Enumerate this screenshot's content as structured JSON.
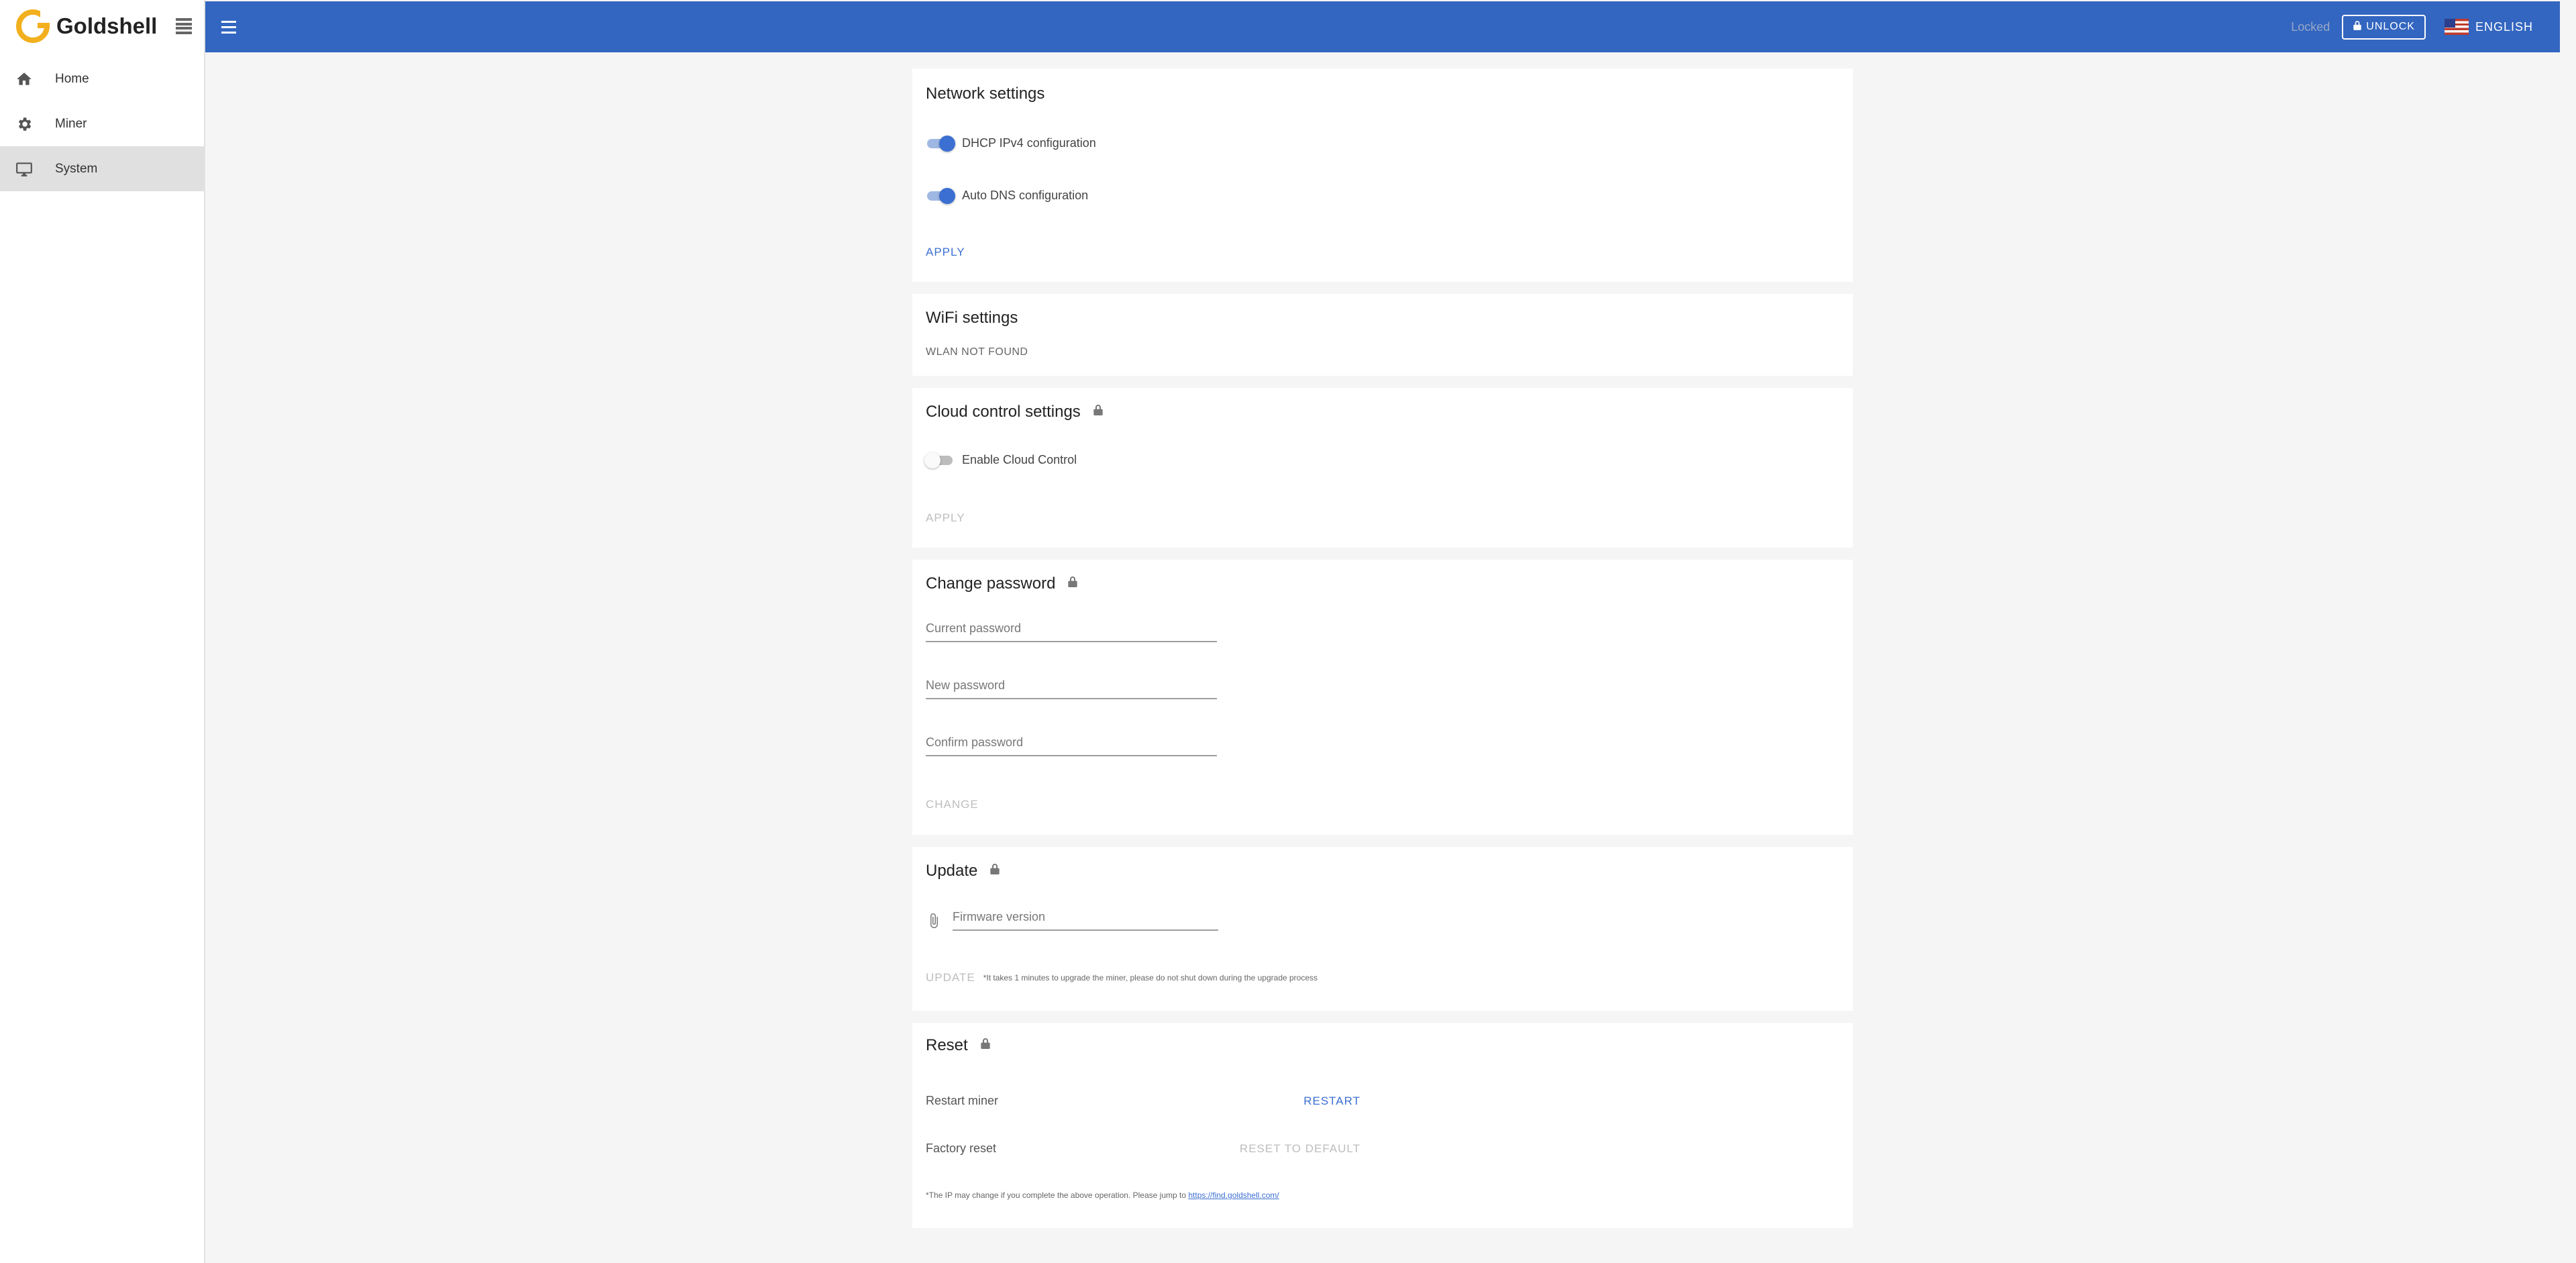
{
  "brand": {
    "name": "Goldshell"
  },
  "sidebar": {
    "items": [
      {
        "label": "Home",
        "icon": "home-icon",
        "active": false
      },
      {
        "label": "Miner",
        "icon": "gear-icon",
        "active": false
      },
      {
        "label": "System",
        "icon": "monitor-icon",
        "active": true
      }
    ]
  },
  "header": {
    "locked_label": "Locked",
    "unlock_label": "UNLOCK",
    "language_label": "ENGLISH",
    "accent_color": "#3366c0"
  },
  "network": {
    "title": "Network settings",
    "dhcp_label": "DHCP IPv4 configuration",
    "dhcp_enabled": true,
    "dns_label": "Auto DNS configuration",
    "dns_enabled": true,
    "apply_label": "APPLY"
  },
  "wifi": {
    "title": "WiFi settings",
    "status": "WLAN NOT FOUND"
  },
  "cloud": {
    "title": "Cloud control settings",
    "enable_label": "Enable Cloud Control",
    "enabled": false,
    "apply_label": "APPLY"
  },
  "password": {
    "title": "Change password",
    "current_placeholder": "Current password",
    "new_placeholder": "New password",
    "confirm_placeholder": "Confirm password",
    "change_label": "CHANGE"
  },
  "update": {
    "title": "Update",
    "firmware_placeholder": "Firmware version",
    "update_label": "UPDATE",
    "note": "*It takes 1 minutes to upgrade the miner, please do not shut down during the upgrade process"
  },
  "reset": {
    "title": "Reset",
    "restart_label": "Restart miner",
    "restart_button": "RESTART",
    "factory_label": "Factory reset",
    "factory_button": "RESET TO DEFAULT",
    "note_prefix": "*The IP may change if you complete the above operation. Please jump to",
    "note_link": "https://find.goldshell.com/"
  }
}
